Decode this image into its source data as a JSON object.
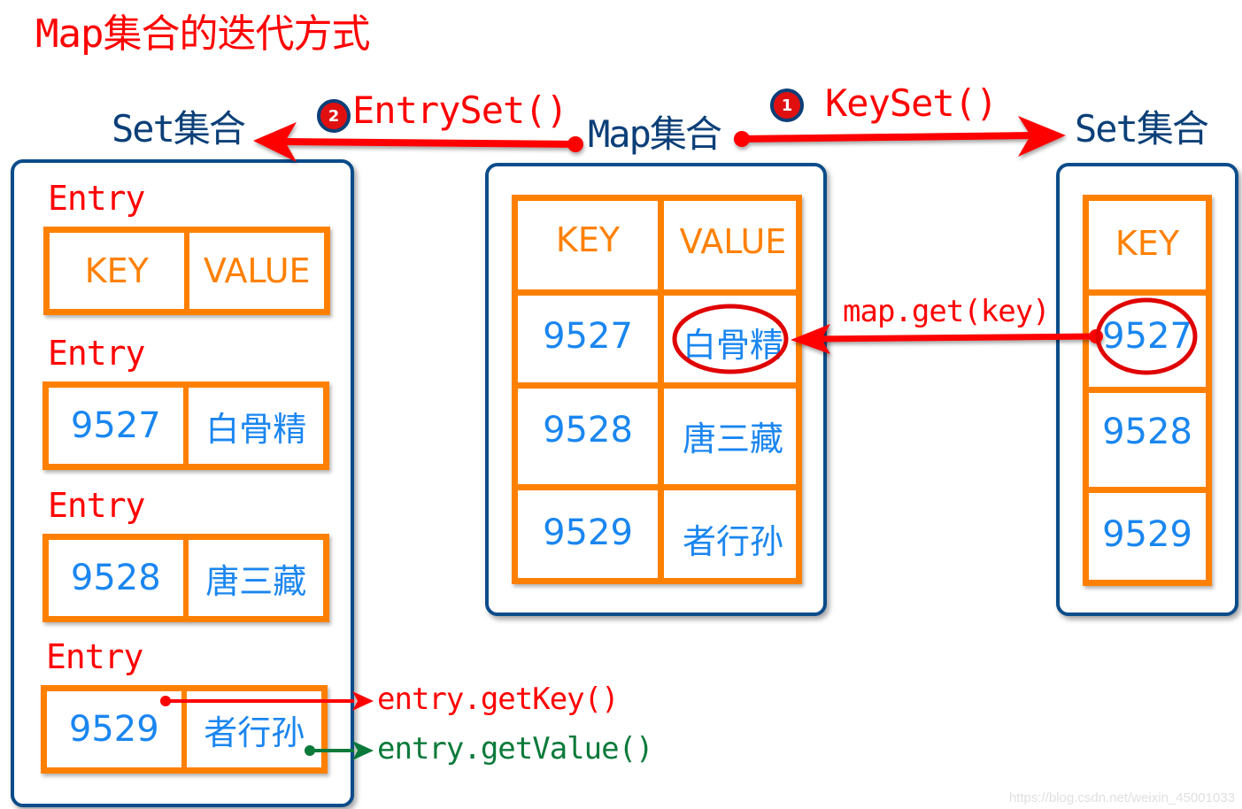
{
  "title": "Map集合的迭代方式",
  "labels": {
    "left_set": "Set集合",
    "map": "Map集合",
    "right_set": "Set集合"
  },
  "methods": {
    "entryset": {
      "badge": "2",
      "label": "EntrySet()"
    },
    "keyset": {
      "badge": "1",
      "label": "KeySet()"
    },
    "map_get": "map.get(key)",
    "get_key": "entry.getKey()",
    "get_value": "entry.getValue()"
  },
  "entry_set": {
    "entry_label": "Entry",
    "entries": [
      {
        "key": "KEY",
        "value": "VALUE"
      },
      {
        "key": "9527",
        "value": "白骨精"
      },
      {
        "key": "9528",
        "value": "唐三藏"
      },
      {
        "key": "9529",
        "value": "者行孙"
      }
    ]
  },
  "map_table": {
    "header": {
      "key": "KEY",
      "value": "VALUE"
    },
    "rows": [
      {
        "key": "9527",
        "value": "白骨精",
        "highlighted": true
      },
      {
        "key": "9528",
        "value": "唐三藏",
        "highlighted": false
      },
      {
        "key": "9529",
        "value": "者行孙",
        "highlighted": false
      }
    ]
  },
  "key_set": {
    "header": "KEY",
    "keys": [
      {
        "key": "9527",
        "highlighted": true
      },
      {
        "key": "9528",
        "highlighted": false
      },
      {
        "key": "9529",
        "highlighted": false
      }
    ]
  },
  "colors": {
    "accent_red": "#ff0000",
    "container_blue": "#0b4c8a",
    "cell_orange": "#ff8000",
    "value_blue": "#1a86f0",
    "getter_green": "#0a7a3a"
  },
  "watermark": "https://blog.csdn.net/weixin_45001033"
}
